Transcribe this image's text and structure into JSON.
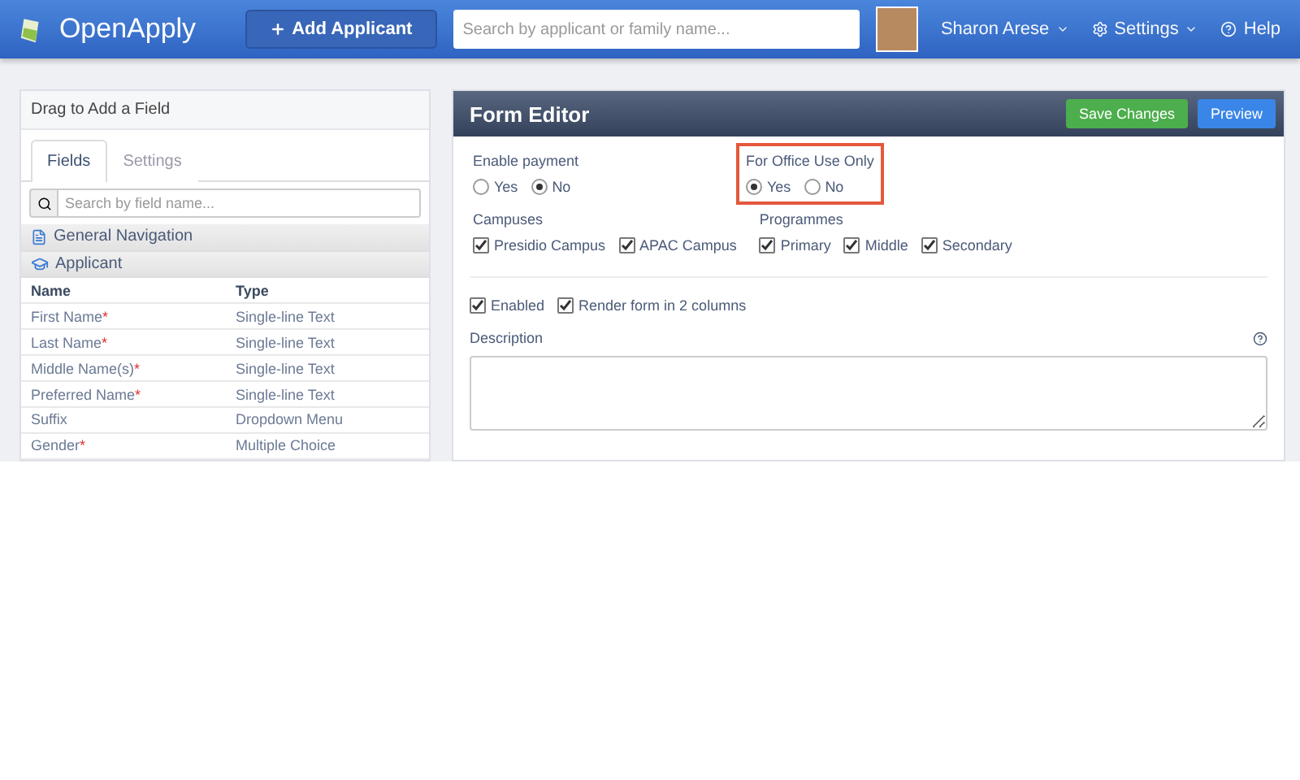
{
  "navbar": {
    "brand": "OpenApply",
    "add_button": "Add Applicant",
    "search": {
      "placeholder": "Search by applicant or family name..."
    },
    "user": "Sharon Arese",
    "settings": "Settings",
    "help": "Help"
  },
  "sidebar": {
    "title": "Drag to Add a Field",
    "tabs": [
      {
        "label": "Fields",
        "selected": true
      },
      {
        "label": "Settings",
        "selected": false
      }
    ],
    "search": {
      "placeholder": "Search by field name..."
    },
    "sections": [
      {
        "kind": "document",
        "label": "General Navigation"
      },
      {
        "kind": "graduation",
        "label": "Applicant"
      }
    ],
    "columns": [
      "Name",
      "Type"
    ],
    "required_mark": "*",
    "rows": [
      {
        "name": "First Name",
        "required": true,
        "type": "Single-line Text"
      },
      {
        "name": "Last Name",
        "required": true,
        "type": "Single-line Text"
      },
      {
        "name": "Middle Name(s)",
        "required": true,
        "type": "Single-line Text"
      },
      {
        "name": "Preferred Name",
        "required": true,
        "type": "Single-line Text"
      },
      {
        "name": "Suffix",
        "required": false,
        "type": "Dropdown Menu"
      },
      {
        "name": "Gender",
        "required": true,
        "type": "Multiple Choice"
      }
    ]
  },
  "editor": {
    "title": "Form Editor",
    "save_button": "Save Changes",
    "preview_button": "Preview",
    "radio_groups": [
      {
        "label": "Enable payment",
        "highlighted": false,
        "options": [
          {
            "label": "Yes",
            "selected": false
          },
          {
            "label": "No",
            "selected": true
          }
        ]
      },
      {
        "label": "For Office Use Only",
        "highlighted": true,
        "options": [
          {
            "label": "Yes",
            "selected": true
          },
          {
            "label": "No",
            "selected": false
          }
        ]
      }
    ],
    "check_groups": [
      {
        "label": "Campuses",
        "options": [
          {
            "label": "Presidio Campus",
            "checked": true
          },
          {
            "label": "APAC Campus",
            "checked": true
          }
        ]
      },
      {
        "label": "Programmes",
        "options": [
          {
            "label": "Primary",
            "checked": true
          },
          {
            "label": "Middle",
            "checked": true
          },
          {
            "label": "Secondary",
            "checked": true
          }
        ]
      }
    ],
    "flags": [
      {
        "label": "Enabled",
        "checked": true
      },
      {
        "label": "Render form in 2 columns",
        "checked": true
      }
    ],
    "description_label": "Description"
  }
}
